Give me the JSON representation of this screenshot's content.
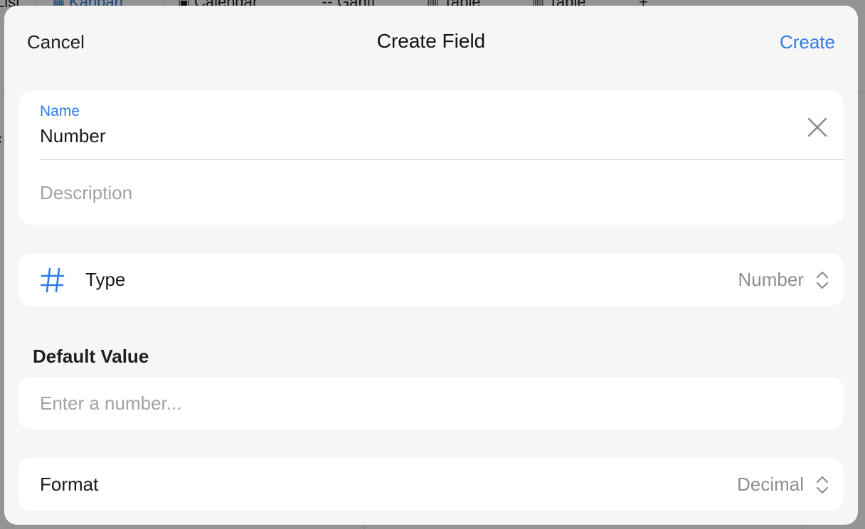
{
  "background": {
    "tabs": [
      "List",
      "Kanban",
      "Calendar",
      "Gantt",
      "Table",
      "Table"
    ],
    "active_tab": "Kanban",
    "add_tab_symbol": "+"
  },
  "modal": {
    "cancel_label": "Cancel",
    "title": "Create Field",
    "create_label": "Create",
    "name_field": {
      "label": "Name",
      "value": "Number",
      "clear_icon": "close-icon"
    },
    "description_field": {
      "placeholder": "Description",
      "value": ""
    },
    "type_row": {
      "icon": "hash-icon",
      "label": "Type",
      "value": "Number"
    },
    "default_value": {
      "heading": "Default Value",
      "placeholder": "Enter a number..."
    },
    "format_row": {
      "label": "Format",
      "value": "Decimal"
    }
  },
  "colors": {
    "accent": "#2f7be6",
    "sheet_background": "#f6f6f6",
    "card_background": "#ffffff",
    "secondary_text": "#8e8e8e",
    "placeholder_text": "#a2a2a2"
  }
}
